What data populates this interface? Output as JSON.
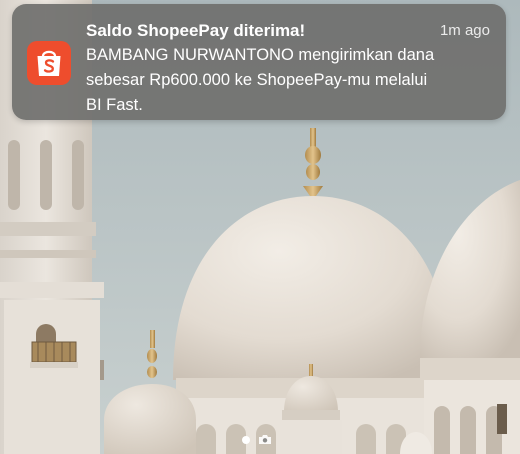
{
  "notification": {
    "app": "ShopeePay",
    "app_icon": "shopee-bag-icon",
    "title": "Saldo ShopeePay diterima!",
    "time": "1m ago",
    "body_lines": [
      "BAMBANG NURWANTONO mengirimkan dana",
      "sebesar Rp600.000 ke ShopeePay-mu melalui",
      "BI Fast."
    ]
  },
  "lockscreen": {
    "page_indicator": [
      "dot",
      "camera-icon"
    ]
  },
  "colors": {
    "notification_bg": "#70706e",
    "shopee_orange": "#ee4d2d",
    "sky": "#b9c4c6",
    "marble": "#e6e0d8"
  }
}
